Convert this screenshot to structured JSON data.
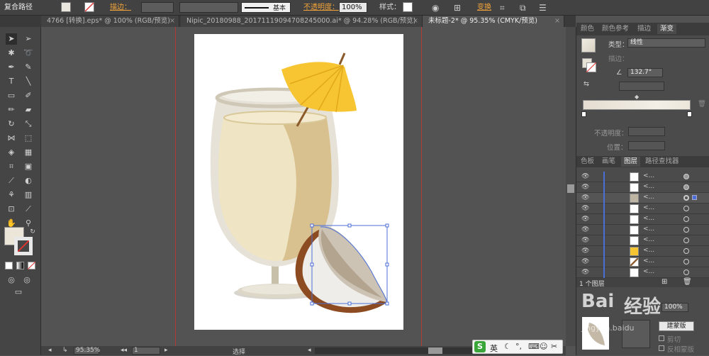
{
  "control_bar": {
    "object_type": "复合路径",
    "stroke_label": "描边：",
    "stroke_line_label": "基本",
    "opacity_label": "不透明度：",
    "opacity_value": "100%",
    "style_label": "样式：",
    "transform_label": "变换"
  },
  "tabs": [
    {
      "label": "4766 [转换].eps* @ 100% (RGB/预览)"
    },
    {
      "label": "Nipic_20180988_20171119094708245000.ai* @ 94.28% (RGB/预览)"
    },
    {
      "label": "未标题-2* @ 95.35% (CMYK/预览)"
    }
  ],
  "gradient_panel": {
    "tabs": [
      "颜色",
      "颜色参考",
      "描边",
      "渐变"
    ],
    "type_label": "类型：",
    "type_value": "线性",
    "stroke_label": "描边：",
    "angle_value": "132.7°",
    "opacity_label": "不透明度：",
    "position_label": "位置："
  },
  "layers_panel": {
    "tabs": [
      "色板",
      "画笔",
      "图层",
      "路径查找器"
    ],
    "rows": [
      {
        "name": "<..."
      },
      {
        "name": "<..."
      },
      {
        "name": "<..."
      },
      {
        "name": "<..."
      },
      {
        "name": "<..."
      },
      {
        "name": "<..."
      },
      {
        "name": "<..."
      },
      {
        "name": "<..."
      },
      {
        "name": "<..."
      },
      {
        "name": "<..."
      }
    ],
    "footer": "1 个图层"
  },
  "transparency_panel": {
    "opacity_value": "100%",
    "make_mask_label": "建蒙版",
    "clip_label": "剪切",
    "invert_label": "反相蒙版"
  },
  "status_bar": {
    "zoom_value": "95.35%",
    "page_value": "1",
    "mode_label": "选择"
  },
  "ime": {
    "lang_label": "英"
  },
  "watermark": {
    "text": "经验",
    "sub": "jingyan.baidu"
  },
  "colors": {
    "accent": "#4b6fd6",
    "guide": "#b23838",
    "umbrella": "#f7c531"
  }
}
